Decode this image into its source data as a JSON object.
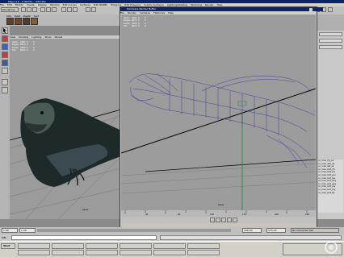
{
  "main_window": {
    "title": "Maya 4.0 - C:\\MAYA\\... Ultimate",
    "menus": [
      "File",
      "Edit",
      "Modify",
      "Create",
      "Display",
      "Window",
      "Edit Curves",
      "Surfaces",
      "Edit NURBS",
      "Polygons",
      "Edit Polygons",
      "Subdiv Surfaces",
      "Lighting/Shading",
      "Texturing",
      "Render",
      "Help"
    ],
    "mode_dropdown": "Rendering",
    "shelf_tabs": [
      "CPS",
      "Deaf",
      "Deaf2",
      "Surf"
    ]
  },
  "left_viewport": {
    "menus": [
      "View",
      "Shading",
      "Lighting",
      "Show",
      "Panels"
    ],
    "hud": [
      {
        "label": "Verts:",
        "value": "4381",
        "a": "0",
        "b": "0"
      },
      {
        "label": "Edges:",
        "value": "8673",
        "a": "0",
        "b": "0"
      },
      {
        "label": "Faces:",
        "value": "4306",
        "a": "0",
        "b": "0"
      },
      {
        "label": "Tris:",
        "value": "8612",
        "a": "0",
        "b": "0"
      }
    ],
    "camera_label": "persp"
  },
  "hardware_window": {
    "title": "Hardware Render Buffer",
    "menus": [
      "File",
      "Render",
      "Cameras",
      "Flipbooks",
      "Help"
    ],
    "hud": [
      {
        "label": "Verts:",
        "value": "4381",
        "a": "0",
        "b": "0"
      },
      {
        "label": "Edges:",
        "value": "8673",
        "a": "0",
        "b": "0"
      },
      {
        "label": "Faces:",
        "value": "4306",
        "a": "0",
        "b": "0"
      },
      {
        "label": "Tris:",
        "value": "8612",
        "a": "0",
        "b": "0"
      }
    ],
    "camera_label": "persp"
  },
  "timeline": {
    "ticks": [
      "40",
      "80",
      "120",
      "170",
      "200",
      "240"
    ],
    "start": "1.00",
    "end": "240.00",
    "current": "1.00",
    "range_end": "275.00",
    "character_set": "No Character Set"
  },
  "right_panel": {
    "channel_items": [
      "nc_mav_fcy_lw",
      "nc_mav_abs_sq",
      "nc_mav_ast_ss",
      "nc_mav_fact_fm",
      "nc_mav_fact_fry",
      "nc_mav_fact_prs",
      "nc_mav_lact_tsy",
      "nc_mav_lact_fmy",
      "nc_mav_lact_gay",
      "nc_mav_lact_srs",
      "nc_mav_lact_fay",
      "nc_mav_lact_fly"
    ]
  },
  "bottom_bar": {
    "command_label": "MEL",
    "start_button": "Start"
  },
  "watermark": "IGN"
}
